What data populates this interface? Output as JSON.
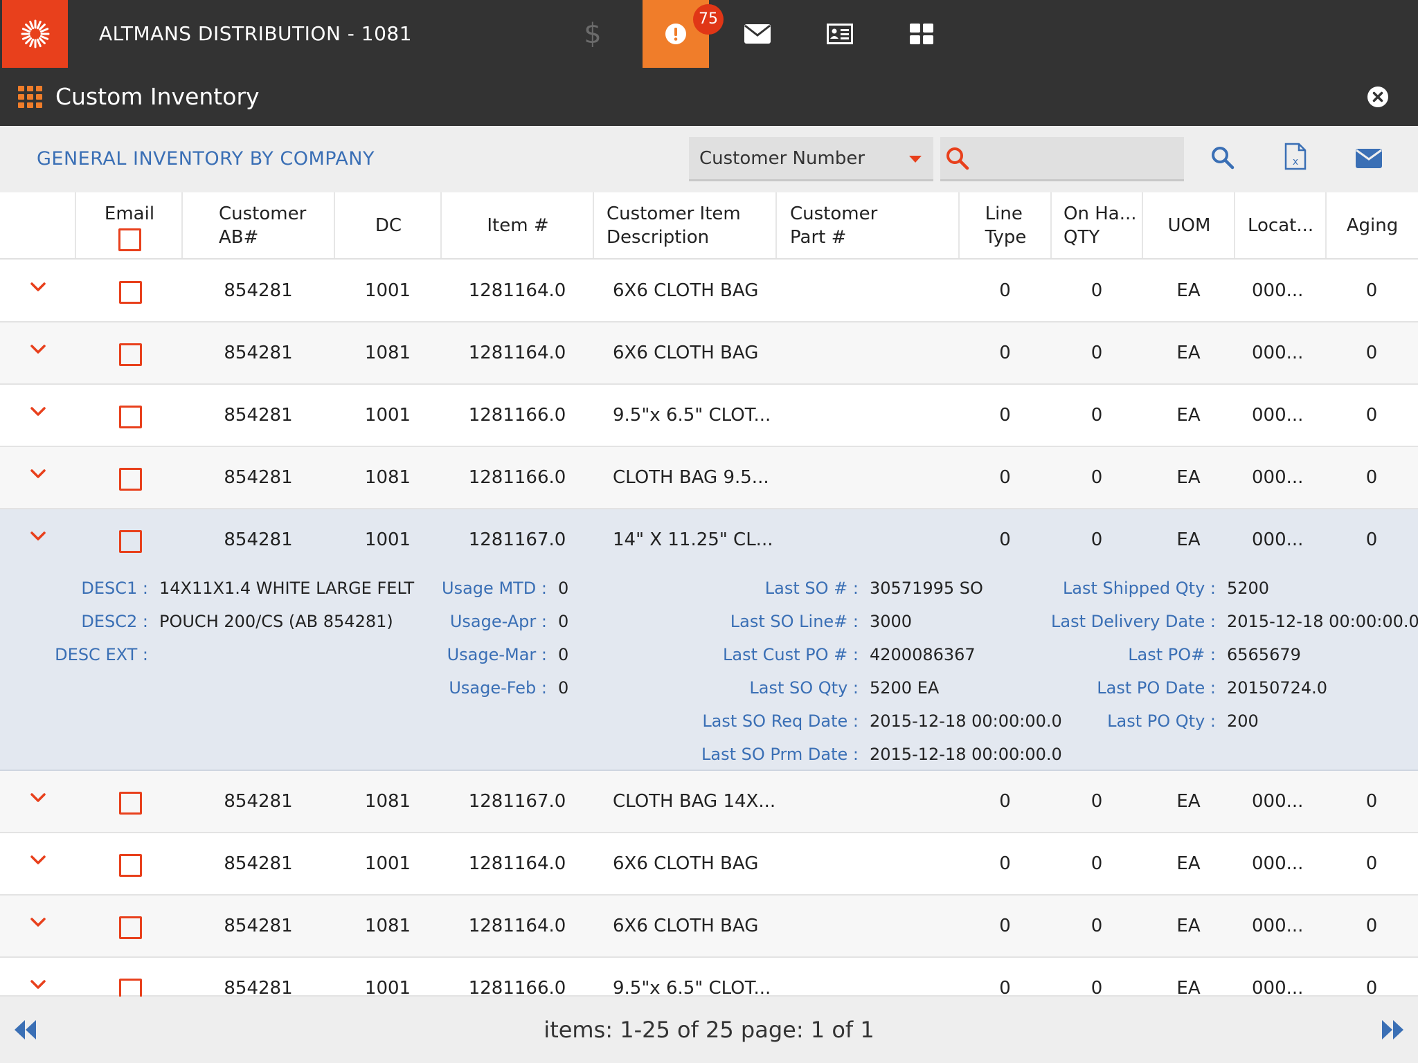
{
  "app": {
    "title": "ALTMANS DISTRIBUTION - 1081",
    "alert_count": "75"
  },
  "page": {
    "title": "Custom Inventory"
  },
  "filter": {
    "section_title": "GENERAL INVENTORY BY COMPANY",
    "select_value": "Customer Number",
    "search_value": ""
  },
  "table": {
    "headers": {
      "email": "Email",
      "customer_ab_1": "Customer",
      "customer_ab_2": "AB#",
      "dc": "DC",
      "item": "Item #",
      "desc_1": "Customer Item",
      "desc_2": "Description",
      "part_1": "Customer",
      "part_2": "Part #",
      "line_1": "Line",
      "line_2": "Type",
      "onhand_1": "On Ha...",
      "onhand_2": "QTY",
      "uom": "UOM",
      "loc": "Locat...",
      "aging": "Aging"
    },
    "rows": [
      {
        "ab": "854281",
        "dc": "1001",
        "item": "1281164.0",
        "desc": "6X6 CLOTH BAG",
        "line": "0",
        "onhand": "0",
        "uom": "EA",
        "loc": "000...",
        "aging": "0"
      },
      {
        "ab": "854281",
        "dc": "1081",
        "item": "1281164.0",
        "desc": "6X6 CLOTH BAG",
        "line": "0",
        "onhand": "0",
        "uom": "EA",
        "loc": "000...",
        "aging": "0"
      },
      {
        "ab": "854281",
        "dc": "1001",
        "item": "1281166.0",
        "desc": "9.5\"x 6.5\" CLOT...",
        "line": "0",
        "onhand": "0",
        "uom": "EA",
        "loc": "000...",
        "aging": "0"
      },
      {
        "ab": "854281",
        "dc": "1081",
        "item": "1281166.0",
        "desc": "CLOTH BAG 9.5...",
        "line": "0",
        "onhand": "0",
        "uom": "EA",
        "loc": "000...",
        "aging": "0"
      },
      {
        "ab": "854281",
        "dc": "1001",
        "item": "1281167.0",
        "desc": "14\" X 11.25\" CL...",
        "line": "0",
        "onhand": "0",
        "uom": "EA",
        "loc": "000...",
        "aging": "0"
      },
      {
        "ab": "854281",
        "dc": "1081",
        "item": "1281167.0",
        "desc": "CLOTH BAG 14X...",
        "line": "0",
        "onhand": "0",
        "uom": "EA",
        "loc": "000...",
        "aging": "0"
      },
      {
        "ab": "854281",
        "dc": "1001",
        "item": "1281164.0",
        "desc": "6X6 CLOTH BAG",
        "line": "0",
        "onhand": "0",
        "uom": "EA",
        "loc": "000...",
        "aging": "0"
      },
      {
        "ab": "854281",
        "dc": "1081",
        "item": "1281164.0",
        "desc": "6X6 CLOTH BAG",
        "line": "0",
        "onhand": "0",
        "uom": "EA",
        "loc": "000...",
        "aging": "0"
      },
      {
        "ab": "854281",
        "dc": "1001",
        "item": "1281166.0",
        "desc": "9.5\"x 6.5\" CLOT...",
        "line": "0",
        "onhand": "0",
        "uom": "EA",
        "loc": "000...",
        "aging": "0"
      }
    ]
  },
  "detail": {
    "desc1_label": "DESC1 :",
    "desc1": "14X11X1.4 WHITE LARGE FELT",
    "desc2_label": "DESC2 :",
    "desc2": "POUCH 200/CS (AB 854281)",
    "descext_label": "DESC EXT :",
    "descext": "",
    "usage_mtd_label": "Usage MTD :",
    "usage_mtd": "0",
    "usage_apr_label": "Usage-Apr :",
    "usage_apr": "0",
    "usage_mar_label": "Usage-Mar :",
    "usage_mar": "0",
    "usage_feb_label": "Usage-Feb :",
    "usage_feb": "0",
    "last_so_label": "Last SO # :",
    "last_so": "30571995 SO",
    "last_so_line_label": "Last SO Line# :",
    "last_so_line": "3000",
    "last_cust_po_label": "Last Cust PO # :",
    "last_cust_po": "4200086367",
    "last_so_qty_label": "Last SO Qty :",
    "last_so_qty": "5200 EA",
    "last_so_req_label": "Last SO Req Date :",
    "last_so_req": "2015-12-18 00:00:00.0",
    "last_so_prm_label": "Last SO Prm Date :",
    "last_so_prm": "2015-12-18 00:00:00.0",
    "last_shipped_label": "Last Shipped Qty :",
    "last_shipped": "5200",
    "last_delivery_label": "Last Delivery Date :",
    "last_delivery": "2015-12-18 00:00:00.0",
    "last_po_label": "Last PO# :",
    "last_po": "6565679",
    "last_po_date_label": "Last PO Date :",
    "last_po_date": "20150724.0",
    "last_po_qty_label": "Last PO Qty :",
    "last_po_qty": "200"
  },
  "footer": {
    "pager": "items: 1-25 of 25 page: 1 of 1"
  },
  "icons": {
    "logo": "sunburst-logo-icon",
    "dollar": "dollar-icon",
    "alert": "alert-icon",
    "mail": "mail-icon",
    "contact": "contact-card-icon",
    "dashboard": "dashboard-icon"
  },
  "colors": {
    "accent": "#e8401c",
    "alert_tab": "#f07d2a",
    "link_blue": "#3a6fb5",
    "topbar": "#333333"
  }
}
